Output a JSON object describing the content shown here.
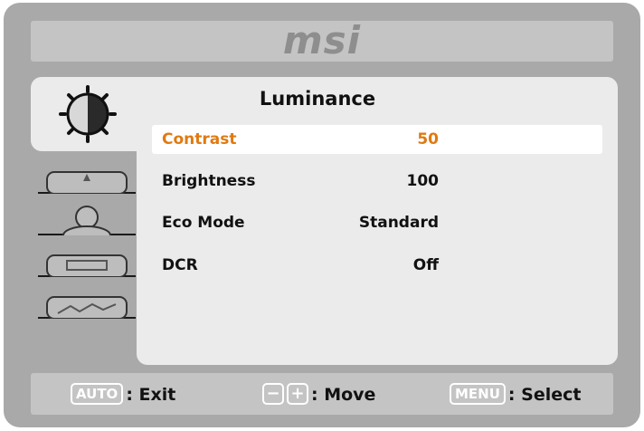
{
  "brand": {
    "logo_text": "msi"
  },
  "panel": {
    "title": "Luminance"
  },
  "menu": {
    "items": [
      {
        "label": "Contrast",
        "value": "50",
        "selected": true
      },
      {
        "label": "Brightness",
        "value": "100",
        "selected": false
      },
      {
        "label": "Eco Mode",
        "value": "Standard",
        "selected": false
      },
      {
        "label": "DCR",
        "value": "Off",
        "selected": false
      }
    ]
  },
  "sidebar": {
    "icons": [
      "luminance-icon",
      "image-icon",
      "color-icon",
      "display-icon",
      "settings-icon"
    ]
  },
  "footer": {
    "auto_key": "AUTO",
    "exit_label": ": Exit",
    "minus_key": "−",
    "plus_key": "+",
    "move_label": ": Move",
    "menu_key": "MENU",
    "select_label": ": Select"
  },
  "colors": {
    "selected_text": "#e07a10",
    "panel_bg": "#ebebeb",
    "frame_bg": "#a9a9a9"
  }
}
